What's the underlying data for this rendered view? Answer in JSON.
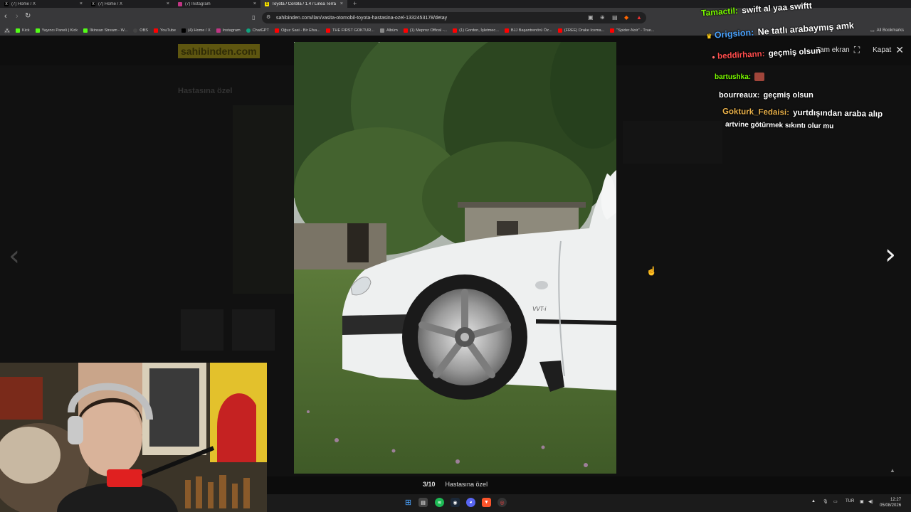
{
  "browser": {
    "tabs": [
      {
        "label": "(7) Home / X",
        "icon": "x-icon",
        "active": false
      },
      {
        "label": "(7) Home / X",
        "icon": "x-icon",
        "active": false
      },
      {
        "label": "(7) Instagram",
        "icon": "instagram-icon",
        "active": false
      },
      {
        "label": "Toyota / Corolla / 1.4 / Linea Terra",
        "icon": "sahibinden-icon",
        "active": true
      }
    ],
    "new_tab": "+",
    "tab_close": "×",
    "url": "sahibinden.com/ilan/vasita-otomobil-toyota-hastasina-ozel-1332453178/detay",
    "bookmarks": [
      {
        "label": "Kick",
        "color": "#53fc18"
      },
      {
        "label": "Yayıncı Paneli | Kick",
        "color": "#53fc18"
      },
      {
        "label": "İlkinsan Stream - W...",
        "color": "#53fc18"
      },
      {
        "label": "OBS",
        "color": "#444444"
      },
      {
        "label": "YouTube",
        "color": "#ff0000"
      },
      {
        "label": "(4) Home / X",
        "color": "#000000"
      },
      {
        "label": "Instagram",
        "color": "#c13584"
      },
      {
        "label": "ChatGPT",
        "color": "#10a37f"
      },
      {
        "label": "Oğuz Sasi - Bir Efsa...",
        "color": "#ff0000"
      },
      {
        "label": "THE FIRST GOKTUR...",
        "color": "#ff0000"
      },
      {
        "label": "Albüm",
        "color": "#888888"
      },
      {
        "label": "(1) Meproz Offical -...",
        "color": "#ff0000"
      },
      {
        "label": "(1) Gordon, İşletmec...",
        "color": "#ff0000"
      },
      {
        "label": "BJJ Başantrenörü Öz...",
        "color": "#ff0000"
      },
      {
        "label": "(FREE) Drake Icema...",
        "color": "#ff0000"
      },
      {
        "label": "\"Spider-Noir\" - True...",
        "color": "#ff0000"
      }
    ],
    "all_bookmarks": "All Bookmarks"
  },
  "site": {
    "logo": "sahibinden.com",
    "listing_title": "Hastasına özel"
  },
  "lightbox": {
    "fullscreen_label": "Tam ekran",
    "close_label": "Kapat",
    "counter": "3/10",
    "caption": "Hastasına özel",
    "prev_arrow": "‹",
    "next_arrow": "›"
  },
  "chat": {
    "messages": [
      {
        "user": "Tamactil:",
        "text": "swift al yaa swiftt",
        "color": "#7cfc00"
      },
      {
        "user": "Origsion:",
        "text": "Ne tatlı arabaymış amk",
        "color": "#4aa3ff"
      },
      {
        "user": "beddirhann:",
        "text": "geçmiş olsun",
        "color": "#ff4d4d"
      },
      {
        "user": "bartushka:",
        "text": "",
        "color": "#7cfc00"
      },
      {
        "user": "bourreaux:",
        "text": "geçmiş olsun",
        "color": "#ffffff"
      },
      {
        "user": "Gokturk_Fedaisi:",
        "text": "yurtdışından araba alıp",
        "color": "#e8b04a"
      },
      {
        "user": "",
        "text": "artvine götürmek sıkıntı olur mu",
        "color": "#ffffff"
      }
    ]
  },
  "taskbar": {
    "language": "TUR",
    "time": "12:27",
    "date": "05/08/2026"
  }
}
